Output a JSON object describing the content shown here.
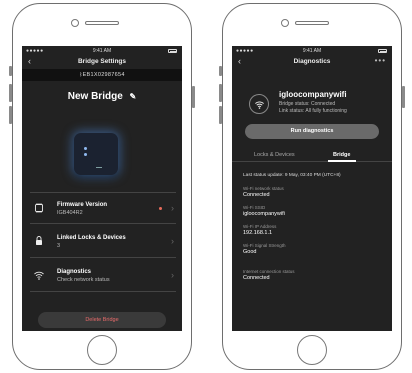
{
  "left_screen": {
    "status_time": "9:41 AM",
    "status_signal": "●●●●● ",
    "nav_title": "Bridge Settings",
    "serial": "EB1X02987654",
    "bridge_name": "New Bridge",
    "list": [
      {
        "label": "Firmware Version",
        "sub": "IGB404R2",
        "icon": "chip-icon",
        "has_alert_dot": true
      },
      {
        "label": "Linked Locks & Devices",
        "sub": "3",
        "icon": "lock-icon",
        "has_alert_dot": false
      },
      {
        "label": "Diagnostics",
        "sub": "Check network status",
        "icon": "wifi-icon",
        "has_alert_dot": false
      }
    ],
    "delete_label": "Delete Bridge"
  },
  "right_screen": {
    "status_time": "9:41 AM",
    "status_signal": "●●●●● ",
    "nav_title": "Diagnostics",
    "network_name": "igloocompanywifi",
    "bridge_status": "Bridge status: Connected",
    "link_status": "Link status: All fully functioning",
    "run_button": "Run diagnostics",
    "tabs": [
      "Locks & Devices",
      "Bridge"
    ],
    "active_tab": "Bridge",
    "last_update": "Last status update: 9 May, 03:40 PM (UTC+8)",
    "fields": [
      {
        "label": "Wi-Fi network status",
        "value": "Connected"
      },
      {
        "label": "Wi-Fi SSID",
        "value": "igloocompanywifi"
      },
      {
        "label": "Wi-Fi IP Address",
        "value": "192.168.1.1"
      },
      {
        "label": "Wi-Fi Signal Strength",
        "value": "Good"
      },
      {
        "label": "Internet connection status",
        "value": "Connected"
      }
    ]
  },
  "colors": {
    "screen_bg": "#222222",
    "accent_red": "#e86b6b",
    "device_glow": "#5a8cdc"
  }
}
